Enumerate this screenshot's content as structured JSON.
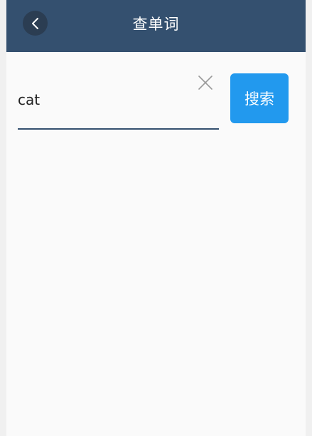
{
  "header": {
    "title": "查单词",
    "back_icon": "chevron-left-icon"
  },
  "search": {
    "value": "cat",
    "clear_icon": "close-icon",
    "button_label": "搜索"
  },
  "colors": {
    "header_bg": "#34506f",
    "accent": "#2299ee",
    "underline": "#34506f",
    "background": "#fafafa"
  }
}
